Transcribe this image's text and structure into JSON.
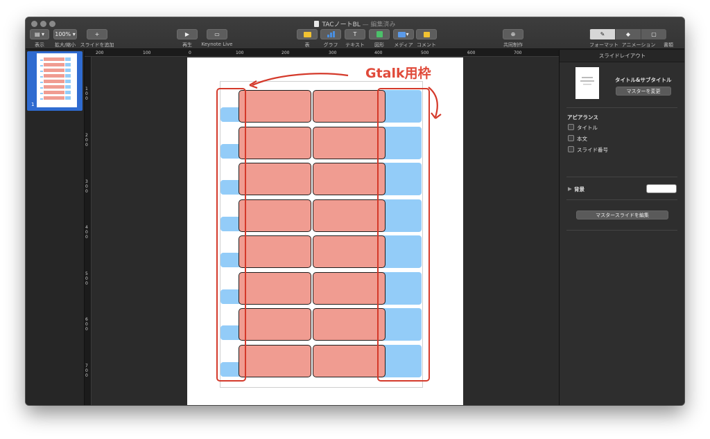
{
  "window": {
    "title": "TACノートBL",
    "title_suffix": " — 編集済み"
  },
  "toolbar": {
    "view_label": "表示",
    "zoom_value": "100%",
    "zoom_label": "拡大/縮小",
    "add_slide_label": "スライドを追加",
    "play_label": "再生",
    "keynote_live_label": "Keynote Live",
    "table_label": "表",
    "chart_label": "グラフ",
    "text_label": "テキスト",
    "shape_label": "図形",
    "media_label": "メディア",
    "comment_label": "コメント",
    "collab_label": "共同制作",
    "format_label": "フォーマット",
    "animate_label": "アニメーション",
    "document_label": "書類"
  },
  "navigator": {
    "slide_number": "1"
  },
  "ruler": {
    "h_ticks": [
      "200",
      "100",
      "0",
      "100",
      "200",
      "300",
      "400",
      "500",
      "600",
      "700"
    ],
    "v_ticks": [
      "100",
      "200",
      "300",
      "400",
      "500",
      "600",
      "700"
    ]
  },
  "annotation": {
    "text": "Gtalk用枠"
  },
  "inspector": {
    "header": "スライドレイアウト",
    "master_name": "タイトル&サブタイトル",
    "change_master": "マスターを変更",
    "appearance_heading": "アピアランス",
    "options": [
      "タイトル",
      "本文",
      "スライド番号"
    ],
    "background_label": "背景",
    "edit_master": "マスタースライドを編集",
    "background_color": "#ffffff"
  },
  "colors": {
    "red_cell": "#f09c91",
    "blue_cell": "#93ccf8",
    "annotation": "#d4392a"
  }
}
